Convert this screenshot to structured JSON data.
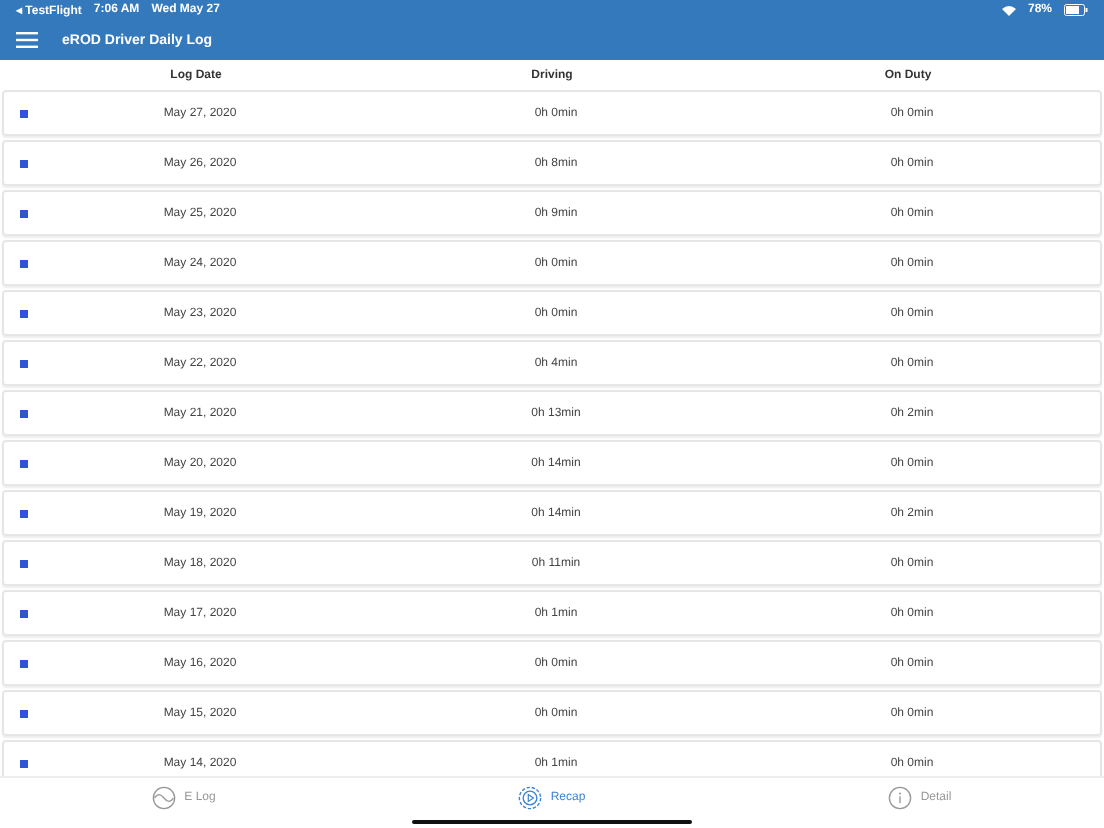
{
  "status_bar": {
    "back": "◂ TestFlight",
    "time": "7:06 AM",
    "date": "Wed May 27",
    "battery": "78%"
  },
  "header": {
    "title": "eROD Driver Daily Log"
  },
  "table": {
    "columns": [
      "Log Date",
      "Driving",
      "On Duty"
    ],
    "rows": [
      {
        "date": "May 27, 2020",
        "driving": "0h 0min",
        "on_duty": "0h 0min"
      },
      {
        "date": "May 26, 2020",
        "driving": "0h 8min",
        "on_duty": "0h 0min"
      },
      {
        "date": "May 25, 2020",
        "driving": "0h 9min",
        "on_duty": "0h 0min"
      },
      {
        "date": "May 24, 2020",
        "driving": "0h 0min",
        "on_duty": "0h 0min"
      },
      {
        "date": "May 23, 2020",
        "driving": "0h 0min",
        "on_duty": "0h 0min"
      },
      {
        "date": "May 22, 2020",
        "driving": "0h 4min",
        "on_duty": "0h 0min"
      },
      {
        "date": "May 21, 2020",
        "driving": "0h 13min",
        "on_duty": "0h 2min"
      },
      {
        "date": "May 20, 2020",
        "driving": "0h 14min",
        "on_duty": "0h 0min"
      },
      {
        "date": "May 19, 2020",
        "driving": "0h 14min",
        "on_duty": "0h 2min"
      },
      {
        "date": "May 18, 2020",
        "driving": "0h 11min",
        "on_duty": "0h 0min"
      },
      {
        "date": "May 17, 2020",
        "driving": "0h 1min",
        "on_duty": "0h 0min"
      },
      {
        "date": "May 16, 2020",
        "driving": "0h 0min",
        "on_duty": "0h 0min"
      },
      {
        "date": "May 15, 2020",
        "driving": "0h 0min",
        "on_duty": "0h 0min"
      },
      {
        "date": "May 14, 2020",
        "driving": "0h 1min",
        "on_duty": "0h 0min"
      }
    ]
  },
  "tabs": [
    {
      "label": "E Log",
      "kind": "wave",
      "selected": false
    },
    {
      "label": "Recap",
      "kind": "play",
      "selected": true
    },
    {
      "label": "Detail",
      "kind": "info",
      "selected": false
    }
  ]
}
